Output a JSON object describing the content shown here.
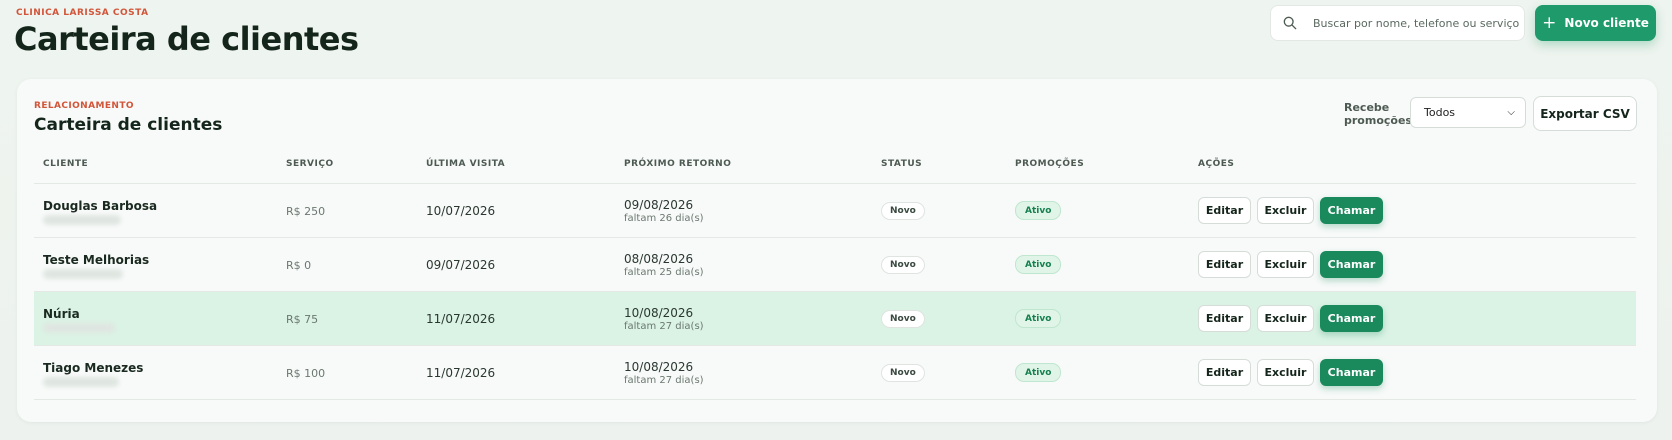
{
  "header": {
    "clinic": "CLINICA LARISSA COSTA",
    "title": "Carteira de clientes",
    "search_placeholder": "Buscar por nome, telefone ou serviço",
    "new_client_label": "Novo cliente"
  },
  "card": {
    "eyebrow": "RELACIONAMENTO",
    "title": "Carteira de clientes",
    "filter_label": "Recebe promoções",
    "filter_value": "Todos",
    "export_label": "Exportar CSV"
  },
  "columns": [
    "CLIENTE",
    "SERVIÇO",
    "ÚLTIMA VISITA",
    "PRÓXIMO RETORNO",
    "STATUS",
    "PROMOÇÕES",
    "AÇÕES"
  ],
  "actions": {
    "edit": "Editar",
    "delete": "Excluir",
    "call": "Chamar"
  },
  "rows": [
    {
      "name": "Douglas Barbosa",
      "service": "R$ 250",
      "last_visit": "10/07/2026",
      "next_return": "09/08/2026",
      "remaining": "faltam 26 dia(s)",
      "status": "Novo",
      "promo": "Ativo"
    },
    {
      "name": "Teste Melhorias",
      "service": "R$ 0",
      "last_visit": "09/07/2026",
      "next_return": "08/08/2026",
      "remaining": "faltam 25 dia(s)",
      "status": "Novo",
      "promo": "Ativo"
    },
    {
      "name": "Núria",
      "service": "R$ 75",
      "last_visit": "11/07/2026",
      "next_return": "10/08/2026",
      "remaining": "faltam 27 dia(s)",
      "status": "Novo",
      "promo": "Ativo"
    },
    {
      "name": "Tiago Menezes",
      "service": "R$ 100",
      "last_visit": "11/07/2026",
      "next_return": "10/08/2026",
      "remaining": "faltam 27 dia(s)",
      "status": "Novo",
      "promo": "Ativo"
    }
  ],
  "colors": {
    "accent": "#1f9a6a",
    "eyebrow": "#d2553a",
    "highlight_row": "#dbf3e5"
  }
}
